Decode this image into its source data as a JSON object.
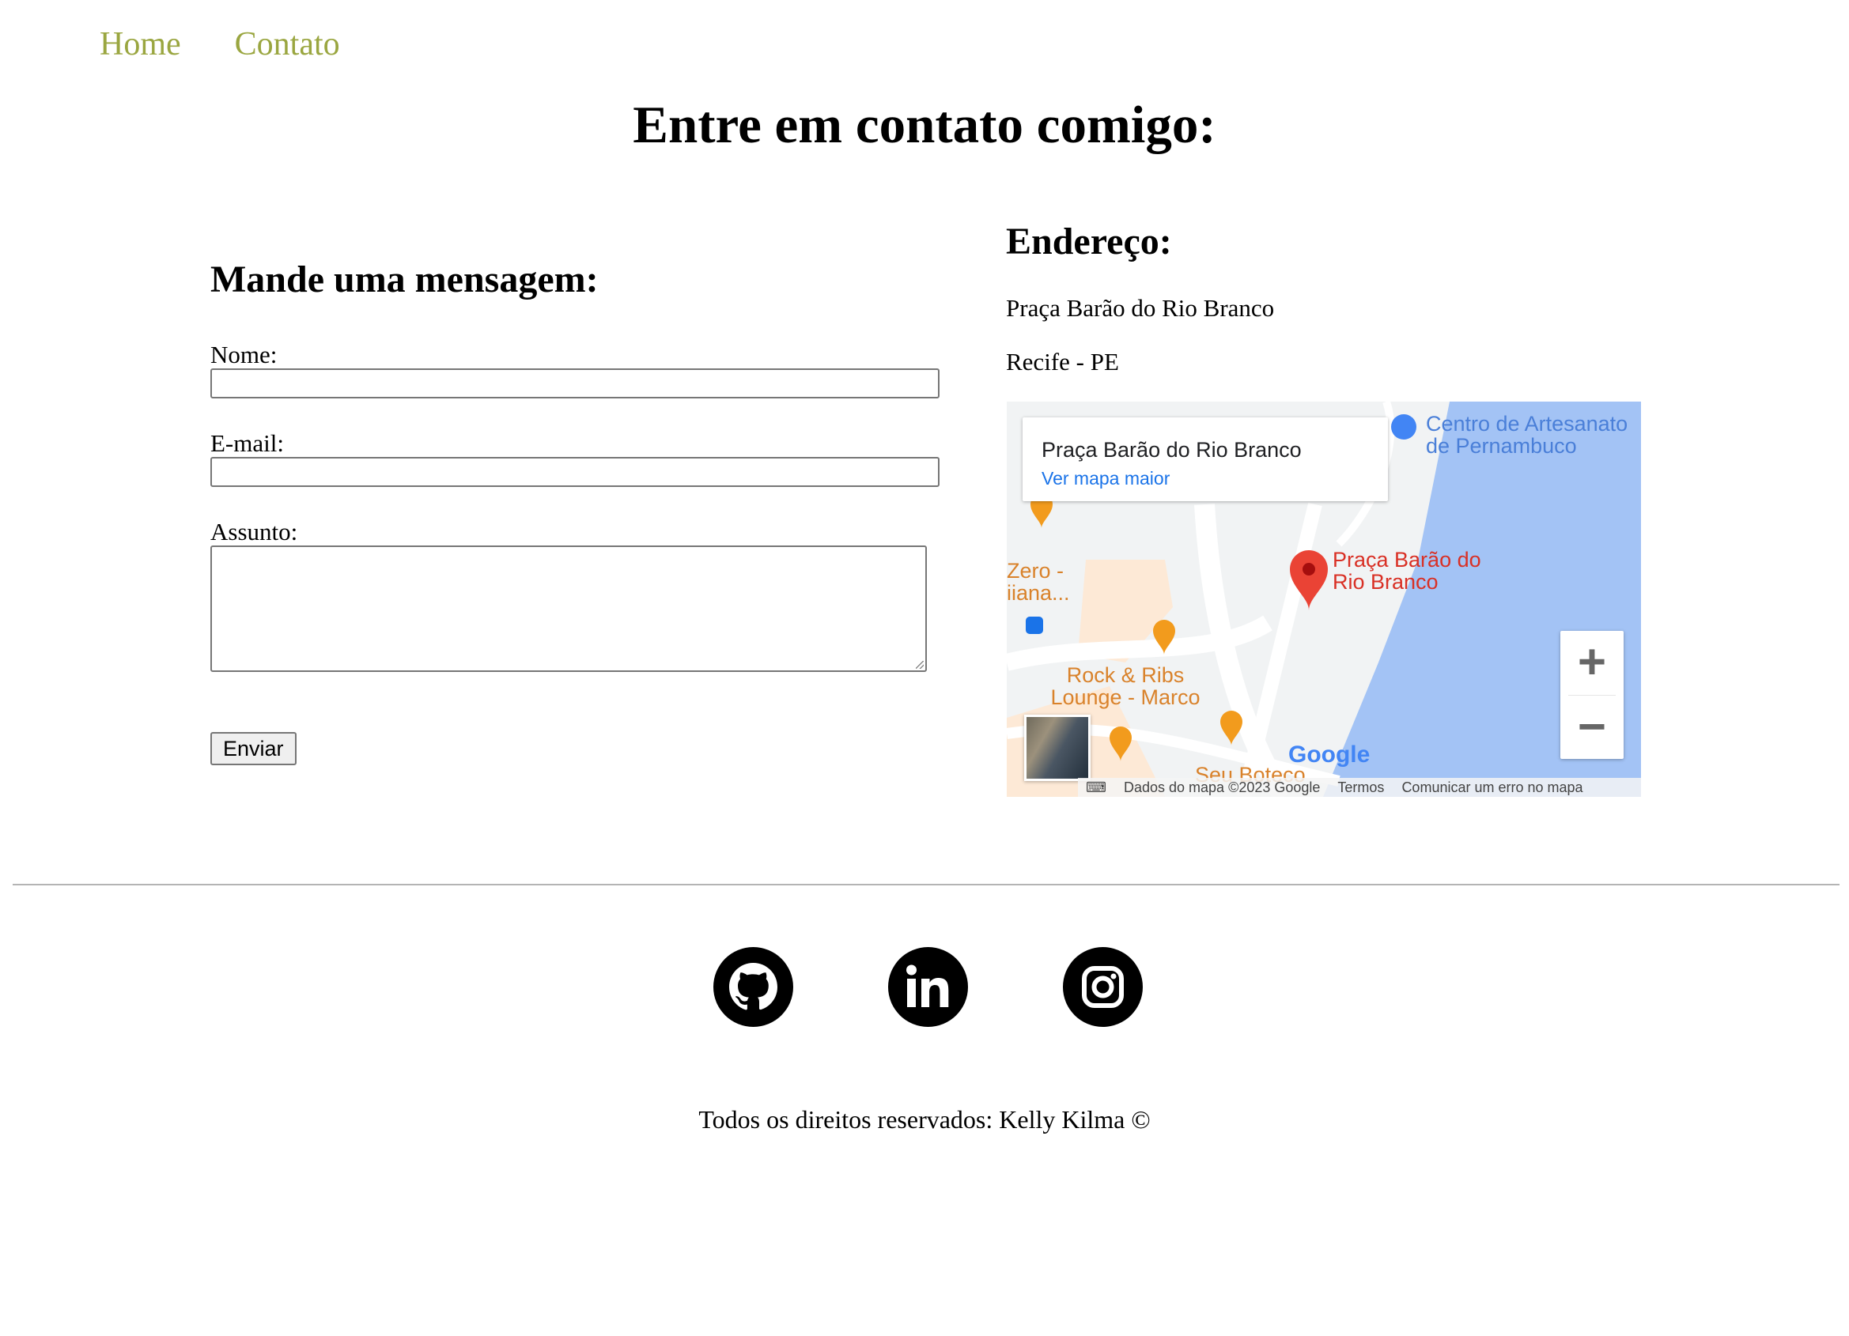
{
  "nav": {
    "items": [
      {
        "label": "Home"
      },
      {
        "label": "Contato"
      }
    ]
  },
  "page_title": "Entre em contato comigo:",
  "form": {
    "title": "Mande uma mensagem:",
    "name_label": "Nome:",
    "name_value": "",
    "email_label": "E-mail:",
    "email_value": "",
    "subject_label": "Assunto:",
    "subject_value": "",
    "submit_label": "Enviar"
  },
  "address": {
    "title": "Endereço:",
    "line1": "Praça Barão do Rio Branco",
    "line2": "Recife - PE"
  },
  "map": {
    "card_place": "Praça Barão do Rio Branco",
    "card_link": "Ver mapa maior",
    "labels": {
      "artesanato": "Centro de Artesanato de Pernambuco",
      "pin": "Praça Barão do Rio Branco",
      "zero": "Zero - iiana...",
      "rock": "Rock & Ribs Lounge - Marco",
      "boteco": "Seu Boteco"
    },
    "zoom_in": "+",
    "zoom_out": "−",
    "logo": "Google",
    "footer": {
      "data": "Dados do mapa ©2023 Google",
      "terms": "Termos",
      "report": "Comunicar um erro no mapa"
    },
    "colors": {
      "water": "#a3c3f5",
      "pin": "#ea4335",
      "poi": "#f29b1d",
      "link": "#1a73e8"
    }
  },
  "social": [
    {
      "icon": "github-icon"
    },
    {
      "icon": "linkedin-icon"
    },
    {
      "icon": "instagram-icon"
    }
  ],
  "footer": {
    "text": "Todos os direitos reservados: Kelly Kilma ©"
  },
  "colors": {
    "nav_link": "#9aa640"
  }
}
